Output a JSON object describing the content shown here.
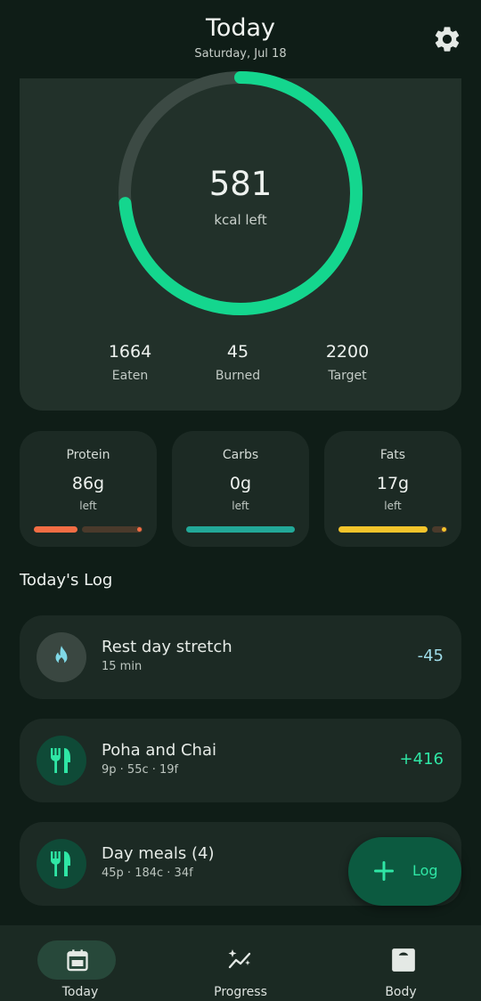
{
  "header": {
    "title": "Today",
    "date": "Saturday, Jul 18",
    "settings_icon": "gear-icon"
  },
  "calories": {
    "remaining": "581",
    "remaining_label": "kcal left",
    "progress_fraction": 0.736,
    "eaten": {
      "value": "1664",
      "label": "Eaten"
    },
    "burned": {
      "value": "45",
      "label": "Burned"
    },
    "target": {
      "value": "2200",
      "label": "Target"
    },
    "colors": {
      "ring": "#14d68e",
      "track": "#3c4a44"
    }
  },
  "macros": [
    {
      "name": "Protein",
      "value": "86g",
      "sub": "left",
      "progress": 0.4,
      "color": "#f26d44"
    },
    {
      "name": "Carbs",
      "value": "0g",
      "sub": "left",
      "progress": 1.0,
      "color": "#22a898"
    },
    {
      "name": "Fats",
      "value": "17g",
      "sub": "left",
      "progress": 0.82,
      "color": "#f3c42b"
    }
  ],
  "log": {
    "title": "Today's Log",
    "items": [
      {
        "name": "Rest day stretch",
        "sub": "15 min",
        "value": "-45",
        "icon": "flame-icon"
      },
      {
        "name": "Poha and Chai",
        "sub": "9p · 55c · 19f",
        "value": "+416",
        "icon": "fork-knife-icon"
      },
      {
        "name": "Day meals (4)",
        "sub": "45p · 184c · 34f",
        "value": "",
        "icon": "fork-knife-icon"
      }
    ]
  },
  "fab": {
    "label": "Log",
    "icon": "plus-icon"
  },
  "nav": {
    "items": [
      {
        "label": "Today",
        "icon": "calendar-icon",
        "active": true
      },
      {
        "label": "Progress",
        "icon": "sparkle-chart-icon",
        "active": false
      },
      {
        "label": "Body",
        "icon": "scale-icon",
        "active": false
      }
    ]
  }
}
